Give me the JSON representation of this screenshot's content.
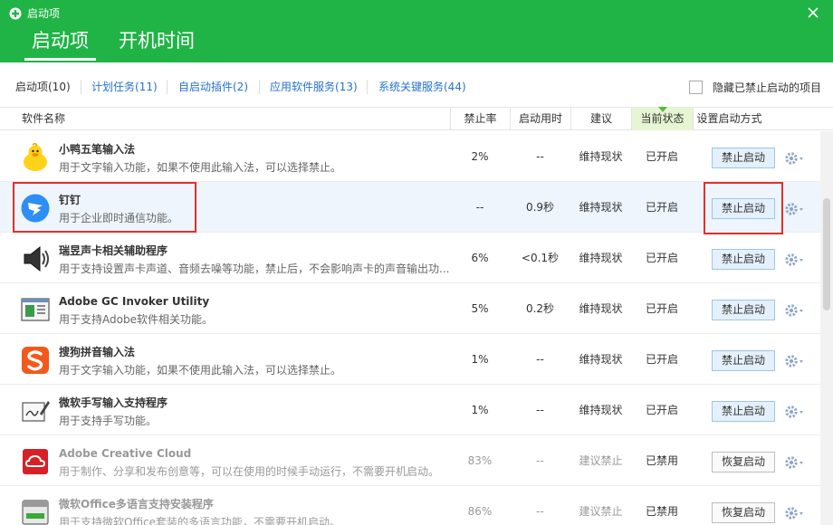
{
  "window": {
    "title": "启动项",
    "close_icon": "close-icon",
    "brand_color": "#20b446"
  },
  "tabs": [
    {
      "label": "启动项",
      "active": true
    },
    {
      "label": "开机时间",
      "active": false
    }
  ],
  "filters": [
    {
      "label": "启动项(10)",
      "active": true
    },
    {
      "label": "计划任务(11)",
      "active": false
    },
    {
      "label": "自启动插件(2)",
      "active": false
    },
    {
      "label": "应用软件服务(13)",
      "active": false
    },
    {
      "label": "系统关键服务(44)",
      "active": false
    }
  ],
  "hide_disabled": {
    "label": "隐藏已禁止启动的项目",
    "checked": false
  },
  "columns": {
    "name": "软件名称",
    "disable_rate": "禁止率",
    "startup_time": "启动用时",
    "advice": "建议",
    "status": "当前状态",
    "setting": "设置启动方式"
  },
  "rows": [
    {
      "icon": "duck-icon",
      "name": "小鸭五笔输入法",
      "desc": "用于文字输入功能，如果不使用此输入法，可以选择禁止。",
      "rate": "2%",
      "time": "--",
      "advice": "维持现状",
      "status": "已开启",
      "button": "禁止启动",
      "enabled": true
    },
    {
      "icon": "dingtalk-icon",
      "name": "钉钉",
      "desc": "用于企业即时通信功能。",
      "rate": "--",
      "time": "0.9秒",
      "advice": "维持现状",
      "status": "已开启",
      "button": "禁止启动",
      "enabled": true
    },
    {
      "icon": "speaker-icon",
      "name": "瑞昱声卡相关辅助程序",
      "desc": "用于支持设置声卡声道、音频去噪等功能，禁止后，不会影响声卡的声音输出功...",
      "rate": "6%",
      "time": "<0.1秒",
      "advice": "维持现状",
      "status": "已开启",
      "button": "禁止启动",
      "enabled": true
    },
    {
      "icon": "window-app-icon",
      "name": "Adobe GC Invoker Utility",
      "desc": "用于支持Adobe软件相关功能。",
      "rate": "5%",
      "time": "0.2秒",
      "advice": "维持现状",
      "status": "已开启",
      "button": "禁止启动",
      "enabled": true
    },
    {
      "icon": "sogou-icon",
      "name": "搜狗拼音输入法",
      "desc": "用于文字输入功能，如果不使用此输入法，可以选择禁止。",
      "rate": "1%",
      "time": "--",
      "advice": "维持现状",
      "status": "已开启",
      "button": "禁止启动",
      "enabled": true
    },
    {
      "icon": "handwriting-icon",
      "name": "微软手写输入支持程序",
      "desc": "用于支持手写功能。",
      "rate": "1%",
      "time": "--",
      "advice": "维持现状",
      "status": "已开启",
      "button": "禁止启动",
      "enabled": true
    },
    {
      "icon": "creative-cloud-icon",
      "name": "Adobe Creative Cloud",
      "desc": "用于制作、分享和发布创意等，可以在使用的时候手动运行，不需要开机启动。",
      "rate": "83%",
      "time": "--",
      "advice": "建议禁止",
      "status": "已禁用",
      "button": "恢复启动",
      "enabled": false
    },
    {
      "icon": "installer-icon",
      "name": "微软Office多语言支持安装程序",
      "desc": "用于支持微软Office套装的多语言功能，不需要开机启动。",
      "rate": "86%",
      "time": "--",
      "advice": "建议禁止",
      "status": "已禁用",
      "button": "恢复启动",
      "enabled": false
    }
  ]
}
